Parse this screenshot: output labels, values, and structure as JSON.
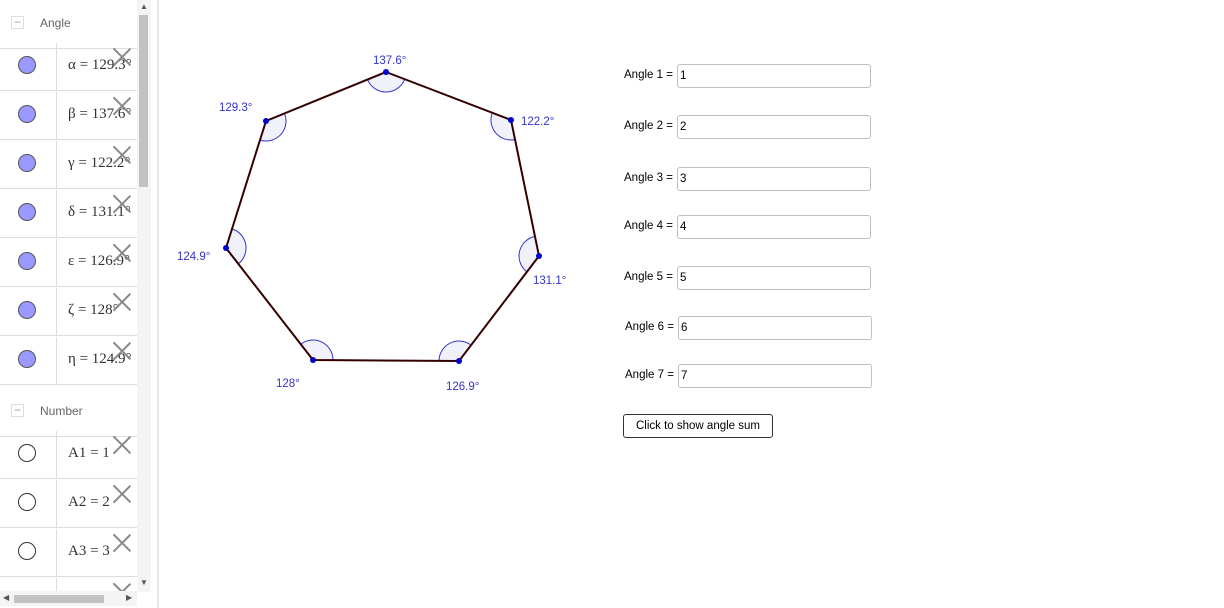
{
  "algebra": {
    "groups": [
      {
        "label": "Angle",
        "toggle": "−",
        "items": [
          {
            "expr": "α = 129.3°"
          },
          {
            "expr": "β = 137.6°"
          },
          {
            "expr": "γ = 122.2°"
          },
          {
            "expr": "δ = 131.1°"
          },
          {
            "expr": "ε = 126.9°"
          },
          {
            "expr": "ζ = 128°"
          },
          {
            "expr": "η = 124.9°"
          }
        ]
      },
      {
        "label": "Number",
        "toggle": "−",
        "items": [
          {
            "expr": "A1 = 1"
          },
          {
            "expr": "A2 = 2"
          },
          {
            "expr": "A3 = 3"
          }
        ]
      }
    ]
  },
  "heptagon": {
    "angle_labels": [
      "137.6°",
      "129.3°",
      "122.2°",
      "124.9°",
      "131.1°",
      "128°",
      "126.9°"
    ],
    "edge_color": "#330000",
    "vertex_color": "#0000cc",
    "label_color": "#3333cc"
  },
  "inputs": [
    {
      "label": "Angle 1 =",
      "value": "1"
    },
    {
      "label": "Angle 2 =",
      "value": "2"
    },
    {
      "label": "Angle 3 =",
      "value": "3"
    },
    {
      "label": "Angle 4 =",
      "value": "4"
    },
    {
      "label": "Angle 5 =",
      "value": "5"
    },
    {
      "label": "Angle 6 =",
      "value": "6"
    },
    {
      "label": "Angle 7 =",
      "value": "7"
    }
  ],
  "button": {
    "label": "Click to show angle sum"
  }
}
